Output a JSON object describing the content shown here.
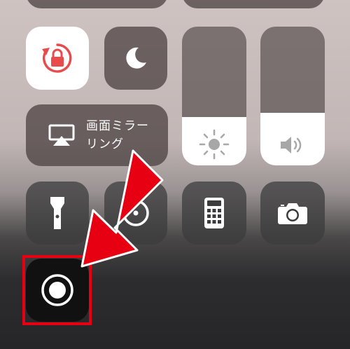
{
  "control_center": {
    "screen_mirroring": {
      "label": "画面ミラー\nリング"
    },
    "brightness": {
      "level_percent": 35
    },
    "volume": {
      "level_percent": 38
    }
  },
  "colors": {
    "highlight": "#e60012",
    "arrow": "#e60012",
    "rotation_lock_accent": "#e84b4b",
    "tile_background": "#463c3c",
    "tile_active": "#ffffff"
  },
  "icons": {
    "rotation_lock": "rotation-lock-icon",
    "do_not_disturb": "moon-icon",
    "screen_mirroring": "airplay-icon",
    "brightness": "sun-icon",
    "volume": "speaker-icon",
    "flashlight": "flashlight-icon",
    "timer": "timer-icon",
    "calculator": "calculator-icon",
    "camera": "camera-icon",
    "screen_recording": "record-icon"
  }
}
